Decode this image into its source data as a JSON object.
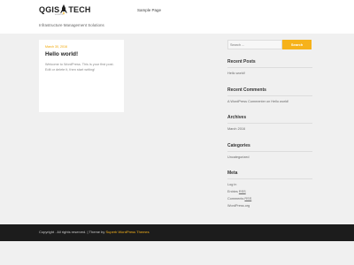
{
  "header": {
    "logo": {
      "left": "QGIS",
      "right": "TECH",
      "sub": "EXPERTS"
    },
    "tagline": "Infrastructure Management Solutions",
    "nav": [
      {
        "label": "Sample Page"
      }
    ]
  },
  "post": {
    "date": "March 30, 2016",
    "title": "Hello world!",
    "excerpt": "Welcome to WordPress. This is your first post. Edit or delete it, then start writing!"
  },
  "sidebar": {
    "search": {
      "placeholder": "Search ...",
      "button": "Search"
    },
    "recent_posts": {
      "title": "Recent Posts",
      "items": [
        "Hello world!"
      ]
    },
    "recent_comments": {
      "title": "Recent Comments",
      "items": [
        "A WordPress Commenter on Hello world!"
      ]
    },
    "archives": {
      "title": "Archives",
      "items": [
        "March 2016"
      ]
    },
    "categories": {
      "title": "Categories",
      "items": [
        "Uncategorized"
      ]
    },
    "meta": {
      "title": "Meta",
      "items": [
        {
          "pre": "Log in",
          "abbr": ""
        },
        {
          "pre": "Entries ",
          "abbr": "RSS"
        },
        {
          "pre": "Comments ",
          "abbr": "RSS"
        },
        {
          "pre": "WordPress.org",
          "abbr": ""
        }
      ]
    }
  },
  "footer": {
    "text": "Copyright . All rights reserved. | Theme by ",
    "link": "Superb WordPress Themes"
  },
  "colors": {
    "accent": "#f6b21b",
    "footer_bg": "#1c1c1c",
    "body_bg": "#f0f0f0"
  }
}
